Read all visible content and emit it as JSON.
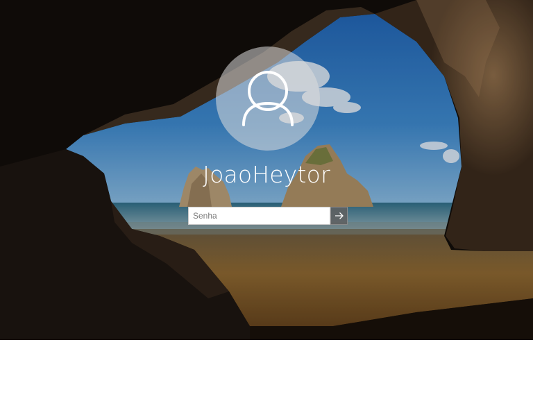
{
  "user": {
    "name": "JoaoHeytor",
    "avatar_icon": "user-icon"
  },
  "login": {
    "password_placeholder": "Senha",
    "password_value": "",
    "submit_icon": "arrow-right-icon"
  },
  "colors": {
    "sky": "#2d72b8",
    "sea": "#3f7f95",
    "sand": "#7b5a2a",
    "cave": "#1a1410",
    "text": "#ffffff"
  }
}
